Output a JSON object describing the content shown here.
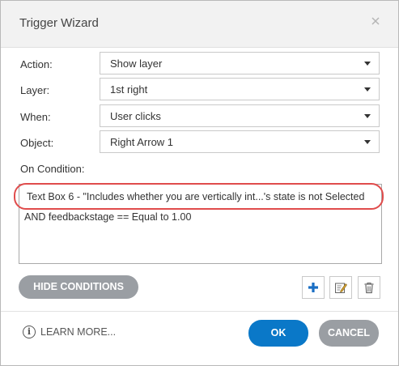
{
  "window": {
    "title": "Trigger Wizard"
  },
  "form": {
    "action": {
      "label": "Action:",
      "value": "Show layer"
    },
    "layer": {
      "label": "Layer:",
      "value": "1st right"
    },
    "when": {
      "label": "When:",
      "value": "User clicks"
    },
    "object": {
      "label": "Object:",
      "value": "Right Arrow 1"
    },
    "on_condition_label": "On Condition:"
  },
  "conditions": [
    "Text Box 6 - \"Includes whether you are vertically int...'s state is not Selected",
    "AND feedbackstage == Equal to 1.00"
  ],
  "buttons": {
    "hide_conditions": "HIDE CONDITIONS",
    "ok": "OK",
    "cancel": "CANCEL",
    "learn_more": "LEARN MORE..."
  },
  "icons": {
    "close": "close-icon",
    "add": "plus-icon",
    "edit": "edit-icon",
    "delete": "trash-icon",
    "info": "info-icon"
  },
  "colors": {
    "accent": "#0a78c8",
    "highlight": "#e04c4c",
    "secondary_button": "#9a9ea3"
  }
}
